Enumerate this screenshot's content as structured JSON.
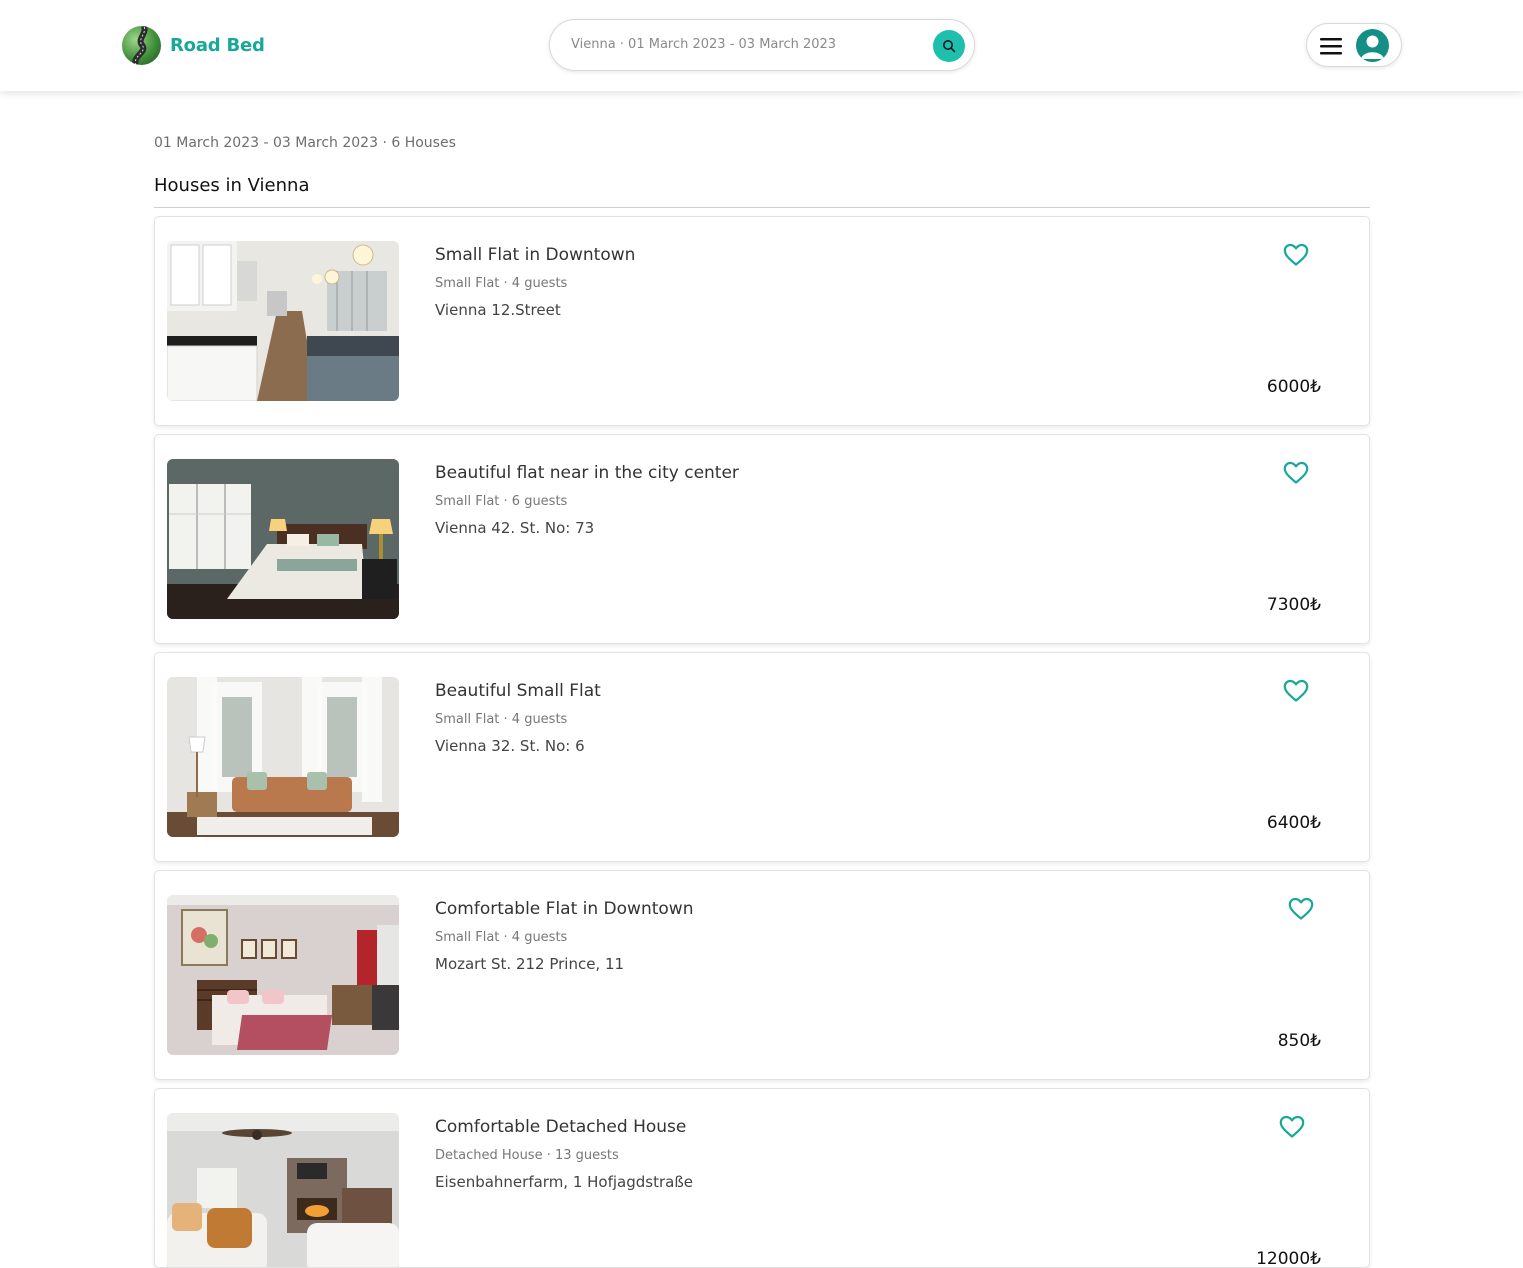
{
  "header": {
    "brand": "Road Bed",
    "search_summary": "Vienna · 01 March 2023 - 03 March 2023"
  },
  "results": {
    "meta": "01 March 2023 - 03 March 2023 · 6 Houses",
    "title": "Houses in Vienna"
  },
  "listings": [
    {
      "title": "Small Flat in Downtown",
      "subtitle": "Small Flat · 4 guests",
      "address": "Vienna 12.Street",
      "price": "6000₺"
    },
    {
      "title": "Beautiful flat near in the city center",
      "subtitle": "Small Flat · 6 guests",
      "address": "Vienna 42. St. No: 73",
      "price": "7300₺"
    },
    {
      "title": "Beautiful Small Flat",
      "subtitle": "Small Flat · 4 guests",
      "address": "Vienna 32. St. No: 6",
      "price": "6400₺"
    },
    {
      "title": "Comfortable Flat in Downtown",
      "subtitle": "Small Flat · 4 guests",
      "address": "Mozart St. 212 Prince, 11",
      "price": "850₺"
    },
    {
      "title": "Comfortable Detached House",
      "subtitle": "Detached House · 13 guests",
      "address": "Eisenbahnerfarm, 1 Hofjagdstraße",
      "price": "12000₺"
    }
  ],
  "icons": {
    "logo": "road-logo-icon",
    "search": "search-icon",
    "menu": "hamburger-menu-icon",
    "user": "user-avatar-icon",
    "favorite": "heart-outline-icon"
  },
  "colors": {
    "accent": "#17a898",
    "search_button": "#1fbfae",
    "avatar": "#138f86"
  }
}
